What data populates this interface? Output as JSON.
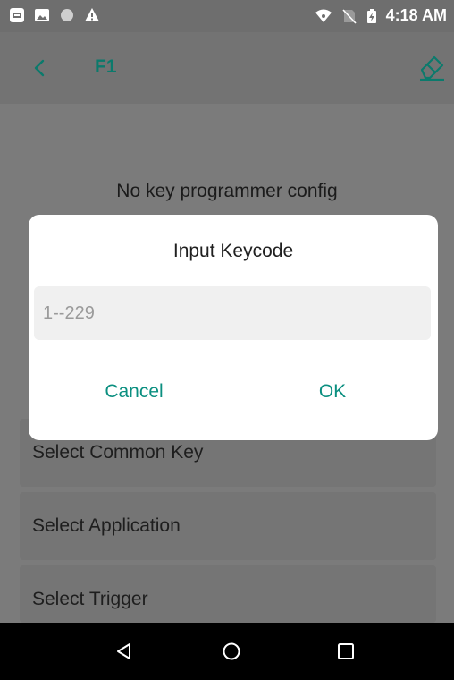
{
  "status_bar": {
    "time": "4:18 AM",
    "left_icons": [
      "sim-card-icon",
      "image-icon",
      "circle-icon",
      "warning-icon"
    ],
    "right_icons": [
      "wifi-icon",
      "no-sim-icon",
      "battery-charging-icon"
    ]
  },
  "toolbar": {
    "title": "F1",
    "back_icon": "chevron-left-icon",
    "action_icon": "eraser-icon"
  },
  "content": {
    "empty_message": "No key programmer config",
    "options": [
      {
        "label": "Select Common Key"
      },
      {
        "label": "Select Application"
      },
      {
        "label": "Select Trigger"
      }
    ]
  },
  "dialog": {
    "title": "Input Keycode",
    "input_value": "",
    "input_placeholder": "1--229",
    "cancel_label": "Cancel",
    "ok_label": "OK"
  },
  "nav_bar": {
    "icons": [
      "back-triangle-icon",
      "home-circle-icon",
      "recents-square-icon"
    ]
  },
  "colors": {
    "accent": "#0b8f80",
    "scrim_background": "#7b7b7b",
    "dialog_background": "#ffffff"
  }
}
